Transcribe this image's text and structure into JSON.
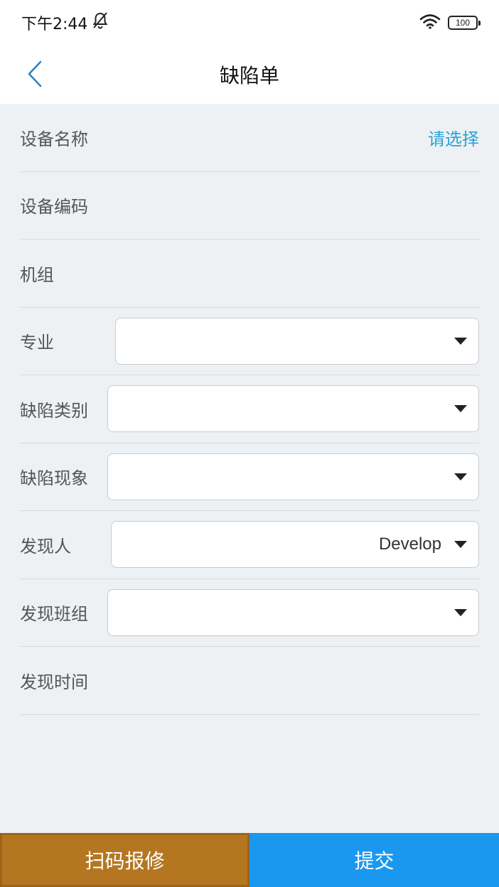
{
  "status_bar": {
    "time": "下午2:44",
    "battery": "100",
    "icons": [
      "bell-off-icon",
      "wifi-icon",
      "battery-icon"
    ]
  },
  "nav": {
    "title": "缺陷单",
    "back_icon": "chevron-left-icon"
  },
  "form": {
    "device_name": {
      "label": "设备名称",
      "value": "请选择"
    },
    "device_code": {
      "label": "设备编码"
    },
    "unit": {
      "label": "机组"
    },
    "specialty": {
      "label": "专业",
      "value": ""
    },
    "defect_category": {
      "label": "缺陷类别",
      "value": ""
    },
    "defect_phenomenon": {
      "label": "缺陷现象",
      "value": ""
    },
    "discoverer": {
      "label": "发现人",
      "value": "Develop"
    },
    "discovery_team": {
      "label": "发现班组",
      "value": ""
    },
    "discovery_time": {
      "label": "发现时间"
    }
  },
  "buttons": {
    "scan_repair": "扫码报修",
    "submit": "提交"
  },
  "colors": {
    "link": "#2aa2d2",
    "scan_button": "#b57621",
    "submit_button": "#1a98f0",
    "background": "#edf1f4"
  }
}
